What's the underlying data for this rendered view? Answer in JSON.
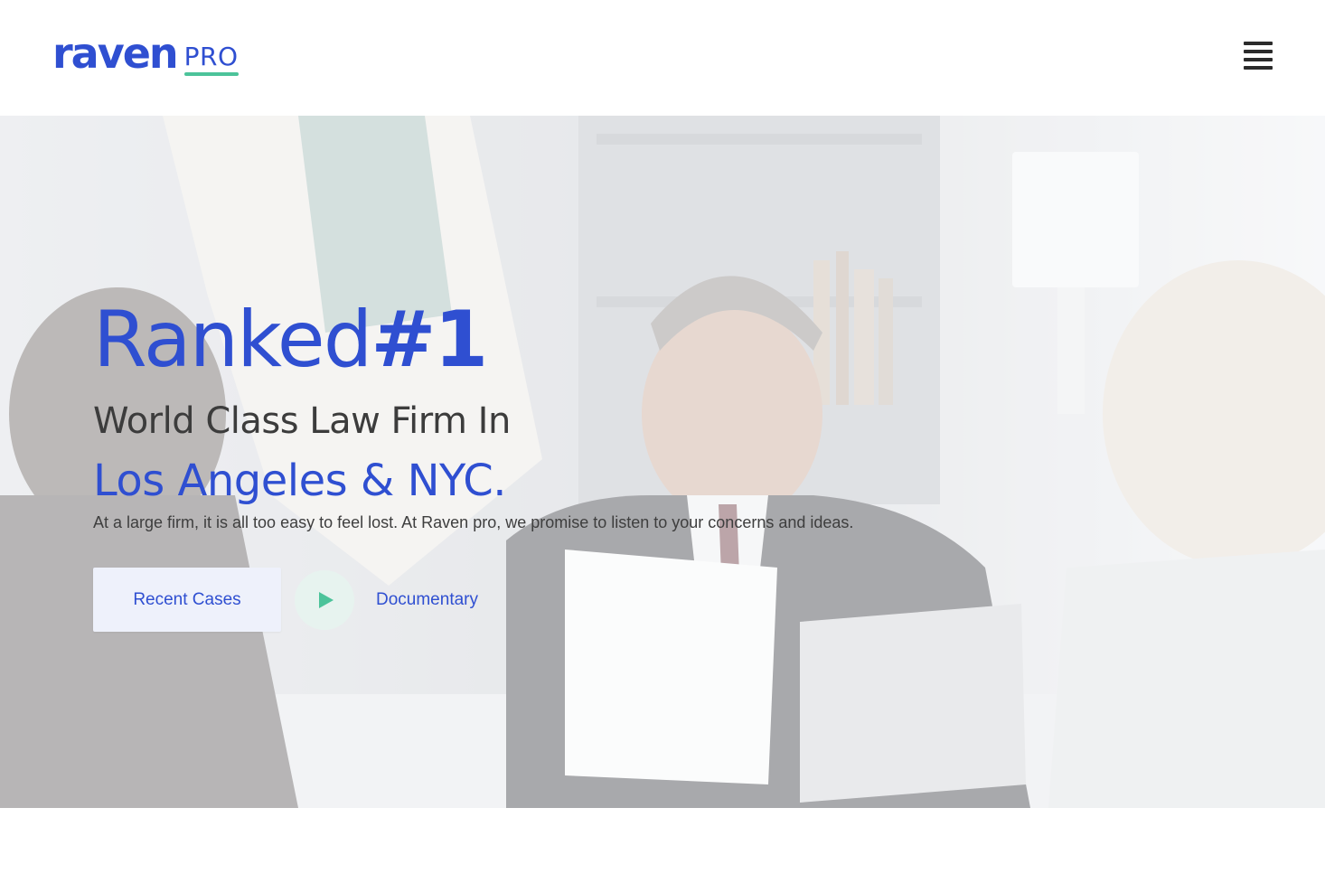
{
  "header": {
    "logo_main": "raven",
    "logo_sub": "PRO",
    "menu_icon": "hamburger-menu-icon"
  },
  "hero": {
    "headline_regular": "Ranked",
    "headline_bold": "#1",
    "subline": "World Class Law Firm In",
    "location": "Los Angeles & NYC.",
    "lead": "At a large firm, it is all too easy to feel lost. At Raven pro, we promise to listen to your concerns and ideas.",
    "primary_button": "Recent Cases",
    "play_icon": "play-icon",
    "documentary_link": "Documentary"
  },
  "colors": {
    "brand_blue": "#2f4fd1",
    "accent_green": "#4cc39a",
    "button_bg": "#eef1fb",
    "play_bg": "#e7f3ef"
  }
}
